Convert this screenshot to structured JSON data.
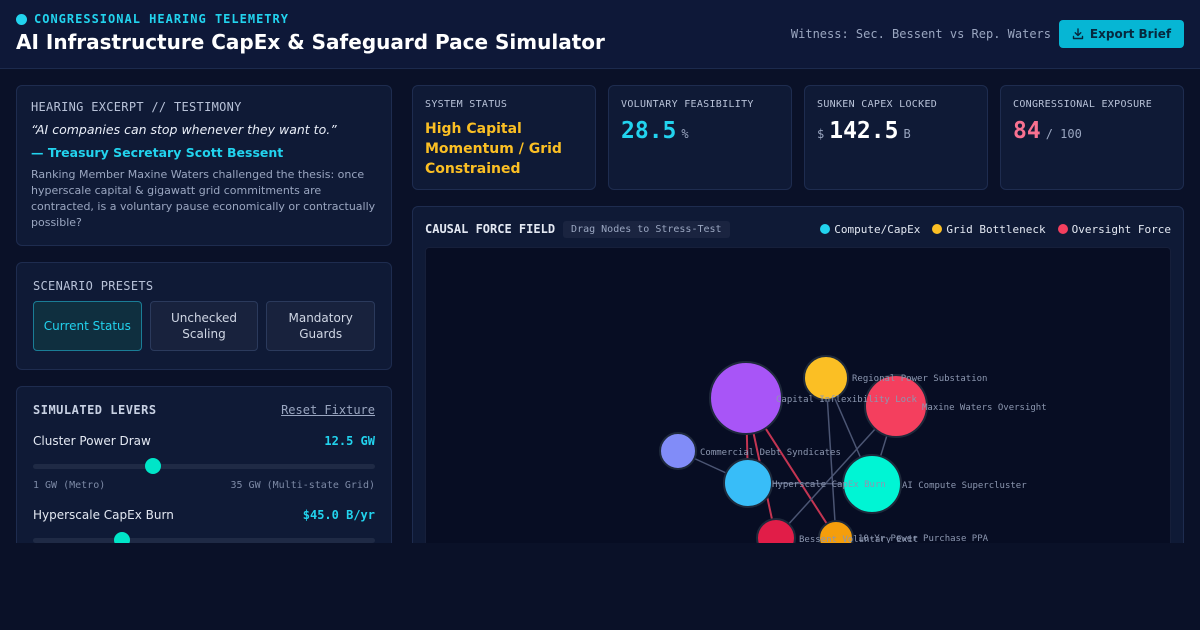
{
  "header": {
    "eyebrow": "CONGRESSIONAL HEARING TELEMETRY",
    "title": "AI Infrastructure CapEx & Safeguard Pace Simulator",
    "witness": "Witness: Sec. Bessent vs Rep. Waters",
    "export_label": "Export Brief",
    "export_icon": "download-icon"
  },
  "excerpt": {
    "label": "HEARING EXCERPT // TESTIMONY",
    "quote": "“AI companies can stop whenever they want to.”",
    "attribution": "— Treasury Secretary Scott Bessent",
    "body": "Ranking Member Maxine Waters challenged the thesis: once hyperscale capital & gigawatt grid commitments are contracted, is a voluntary pause economically or contractually possible?"
  },
  "presets": {
    "label": "SCENARIO PRESETS",
    "items": [
      {
        "label": "Current Status",
        "active": true
      },
      {
        "label": "Unchecked Scaling",
        "active": false
      },
      {
        "label": "Mandatory Guards",
        "active": false
      }
    ]
  },
  "levers": {
    "title": "SIMULATED LEVERS",
    "reset_label": "Reset Fixture",
    "items": [
      {
        "name": "Cluster Power Draw",
        "value": "12.5 GW",
        "min_label": "1 GW (Metro)",
        "max_label": "35 GW (Multi-state Grid)",
        "level": 0.35
      },
      {
        "name": "Hyperscale CapEx Burn",
        "value": "$45.0 B/yr",
        "level": 0.26
      }
    ]
  },
  "cards": [
    {
      "label": "SYSTEM STATUS",
      "value": "High Capital Momentum / Grid Constrained",
      "color": "#fbbf24"
    },
    {
      "label": "VOLUNTARY FEASIBILITY",
      "prefix": "",
      "value": "28.5",
      "unit": "%",
      "color": "#22d3ee"
    },
    {
      "label": "SUNKEN CAPEX LOCKED",
      "prefix": "$",
      "value": "142.5",
      "unit": "B",
      "color": "#ffffff"
    },
    {
      "label": "CONGRESSIONAL EXPOSURE",
      "prefix": "",
      "value": "84",
      "unit": "/ 100",
      "color": "#f87190"
    }
  ],
  "force_field": {
    "title": "CAUSAL FORCE FIELD",
    "tag": "Drag Nodes to Stress-Test",
    "legend": [
      {
        "label": "Compute/CapEx",
        "color": "#22d3ee"
      },
      {
        "label": "Grid Bottleneck",
        "color": "#fbbf24"
      },
      {
        "label": "Oversight Force",
        "color": "#f43f5e"
      }
    ],
    "nodes": [
      {
        "label": "Capital Inflexibility Lock",
        "color": "#a855f7"
      },
      {
        "label": "Regional Power Substation",
        "color": "#fbbf24"
      },
      {
        "label": "Maxine Waters Oversight",
        "color": "#f43f5e"
      },
      {
        "label": "Commercial Debt Syndicates",
        "color": "#818cf8"
      },
      {
        "label": "Hyperscale CapEx Burn",
        "color": "#38bdf8"
      },
      {
        "label": "AI Compute Supercluster",
        "color": "#00f5d4"
      },
      {
        "label": "Bessent Voluntary Exit",
        "color": "#e11d48"
      },
      {
        "label": "10-Yr Power Purchase PPA",
        "color": "#f59e0b"
      }
    ]
  }
}
